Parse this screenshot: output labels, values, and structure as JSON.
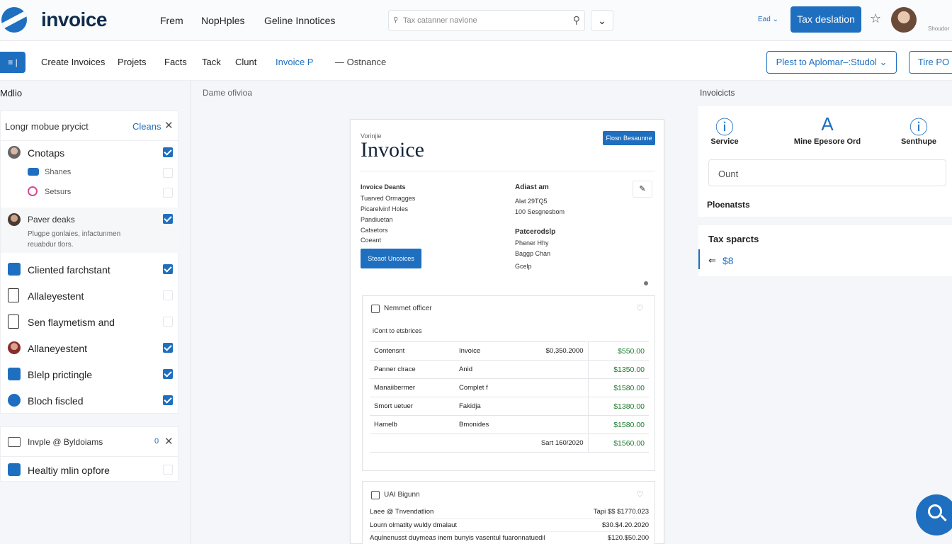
{
  "app": {
    "logo_text": "invoice"
  },
  "topnav": [
    {
      "label": "Frem"
    },
    {
      "label": "NopHples"
    },
    {
      "label": "Geline Innotices"
    }
  ],
  "search": {
    "placeholder": "Tax catanner navione"
  },
  "lang": "Ead ⌄",
  "tax_button": "Tax deslation",
  "user_label": "Shoudor",
  "subnav": [
    {
      "label": "Create Invoices"
    },
    {
      "label": "Projets"
    },
    {
      "label": "Facts"
    },
    {
      "label": "Tack"
    },
    {
      "label": "Clunt"
    },
    {
      "label": "Invoice P"
    }
  ],
  "subnav_tail": "— Ostnance",
  "subbar_icon_label": "≡ |",
  "action_buttons": {
    "primary": "Plest to Aplomar–:Studol ⌄",
    "secondary": "Tire PO"
  },
  "left": {
    "title": "Mdlio",
    "card1": {
      "header": "Longr mobue prycict",
      "action": "Cleans",
      "items": [
        {
          "label": "Cnotaps",
          "checked": true
        },
        {
          "label": "Shanes",
          "checked": false
        },
        {
          "label": "Setsurs",
          "checked": false
        },
        {
          "label": "Paver deaks",
          "checked": true,
          "sub": "Plugpe gonlaies, infactunmen reuabdur tlors."
        },
        {
          "label": "Cliented farchstant",
          "checked": true
        },
        {
          "label": "Allaleyestent",
          "checked": false
        },
        {
          "label": "Sen flaymetism and",
          "checked": false
        },
        {
          "label": "Allaneyestent",
          "checked": true
        },
        {
          "label": "Blelp prictingle",
          "checked": true
        },
        {
          "label": "Bloch fiscled",
          "checked": true
        }
      ]
    },
    "card2": {
      "header": "Invple @ Byldoiams",
      "count": "0",
      "items": [
        {
          "label": "Healtiy mlin opfore",
          "checked": false
        }
      ]
    }
  },
  "crumb": "Dame ofivioa",
  "invoice": {
    "small_label": "Vorinjie",
    "title": "Invoice",
    "top_button": "Flosn Besaunne",
    "details_head": "Invoice Deants",
    "details": [
      "Tuarved Ormagges",
      "Picarelvinf Holes",
      "Pandiuetan",
      "Catsetors",
      "Coeant"
    ],
    "details_button": "Steaot Uncoices",
    "addr_head": "Adiast am",
    "addr": [
      "Alat 29TQ5",
      "100 Sesgnesbom"
    ],
    "pay_head": "Patcerodslp",
    "pay": [
      "Phener Hhy",
      "Baggp Chan",
      "Gcelp"
    ],
    "section1": {
      "title": "Nemmet officer",
      "subtitle": "iCont to etsbrices",
      "rows": [
        {
          "c1": "Contensnt",
          "c2": "Invoice",
          "c3": "$0,350.2000",
          "c4": "$550.00"
        },
        {
          "c1": "Panner clrace",
          "c2": "Anid",
          "c3": "",
          "c4": "$1350.00"
        },
        {
          "c1": "Manaiibermer",
          "c2": "Complet f",
          "c3": "",
          "c4": "$1580.00"
        },
        {
          "c1": "Smort uetuer",
          "c2": "Fakidja",
          "c3": "",
          "c4": "$1380.00"
        },
        {
          "c1": "Hamelb",
          "c2": "Bmonides",
          "c3": "",
          "c4": "$1580.00"
        },
        {
          "c1": "",
          "c2": "",
          "c3": "Sart 160/2020",
          "c4": "$1560.00"
        }
      ]
    },
    "section2": {
      "title": "UAI Bigunn",
      "rows": [
        {
          "l": "Laee @ Tnvendatlion",
          "r": "Tapi $$ $1770.023"
        },
        {
          "l": "Lourn olmatity wuldy dmalaut",
          "r": "$30.$4.20.2020"
        },
        {
          "l": "Aqulnenusst duymeas inem bunyis vasentul fuaronnatuedil",
          "r": "$120.$50.200"
        }
      ]
    }
  },
  "right": {
    "title": "Invoicicts",
    "services": [
      {
        "glyph": "ⓘ",
        "label": "Service"
      },
      {
        "glyph": "A",
        "label": "Mine Epesore Ord"
      },
      {
        "glyph": "ⓘ",
        "label": "Senthupe"
      }
    ],
    "input_placeholder": "Ount",
    "section_label": "Ploenatsts",
    "tax_label": "Tax sparcts",
    "tax_arrow": "⇐",
    "tax_value": "$8"
  }
}
